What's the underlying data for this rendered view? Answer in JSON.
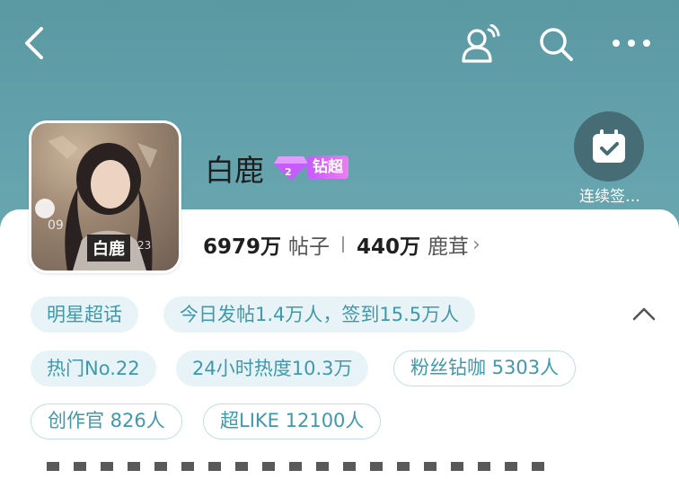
{
  "topbar": {
    "back_icon": "chevron-left-icon",
    "listen_icon": "user-broadcast-icon",
    "search_icon": "search-icon",
    "more_icon": "more-horizontal-icon"
  },
  "profile": {
    "name": "白鹿",
    "badge_label": "钻超",
    "avatar_tag": "白鹿"
  },
  "checkin": {
    "label": "连续签…"
  },
  "stats": {
    "posts_count": "6979万",
    "posts_label": "帖子",
    "fans_count": "440万",
    "fans_label": "鹿茸"
  },
  "tags": {
    "row1": [
      "明星超话",
      "今日发帖1.4万人，签到15.5万人"
    ],
    "row2": [
      "热门No.22",
      "24小时热度10.3万",
      "粉丝钻咖 5303人"
    ],
    "row3": [
      "创作官 826人",
      "超LIKE 12100人"
    ]
  },
  "colors": {
    "header_bg": "#62a1ab",
    "chip_text": "#3f99aa",
    "chip_bg": "#e7f3f6",
    "badge_purple": "#c65bff"
  }
}
